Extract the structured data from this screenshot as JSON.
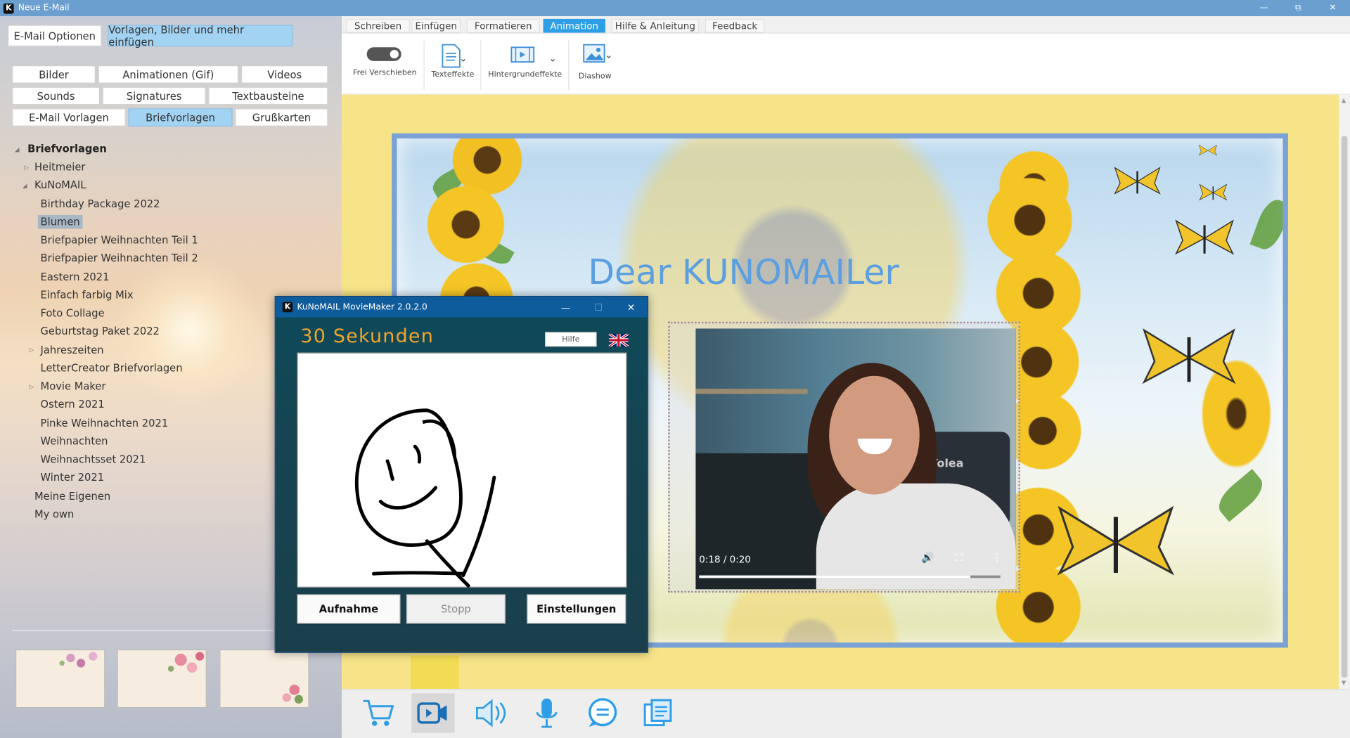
{
  "window": {
    "title": "Neue E-Mail",
    "logo_letter": "K",
    "controls": {
      "minimize": "—",
      "restore": "⧉",
      "close": "✕"
    }
  },
  "left": {
    "main_buttons": [
      "E-Mail Optionen",
      "Vorlagen, Bilder und mehr einfügen"
    ],
    "categories": [
      "Bilder",
      "Animationen (Gif)",
      "Videos",
      "Sounds",
      "Signatures",
      "Textbausteine",
      "E-Mail Vorlagen",
      "Briefvorlagen",
      "Grußkarten"
    ],
    "tree": [
      "Briefvorlagen",
      "Heitmeier",
      "KuNoMAIL",
      "Birthday Package 2022",
      "Blumen",
      "Briefpapier Weihnachten Teil 1",
      "Briefpapier Weihnachten Teil 2",
      "Eastern 2021",
      "Einfach farbig Mix",
      "Foto Collage",
      "Geburtstag Paket 2022",
      "Jahreszeiten",
      "LetterCreator Briefvorlagen",
      "Movie Maker",
      "Ostern 2021",
      "Pinke Weihnachten 2021",
      "Weihnachten",
      "Weihnachtsset 2021",
      "Winter 2021",
      "Meine Eigenen",
      "My own"
    ]
  },
  "ribbon": {
    "tabs": [
      "Schreiben",
      "Einfügen",
      "Formatieren",
      "Animation",
      "Hilfe & Anleitung",
      "Feedback"
    ],
    "active_tab": "Animation",
    "groups": [
      "Frei Verschieben",
      "Texteffekte",
      "Hintergrundeffekte",
      "Diashow"
    ]
  },
  "editor": {
    "greeting": "Dear KUNOMAILer",
    "video": {
      "time": "0:18 / 0:20",
      "progress": 0.9,
      "shirt_text": "Yolea"
    }
  },
  "dialog": {
    "title": "KuNoMAIL MovieMaker 2.0.2.0",
    "heading": "30 Sekunden",
    "help": "Hilfe",
    "buttons": [
      "Aufnahme",
      "Stopp",
      "Einstellungen"
    ]
  },
  "colors": {
    "accent": "#2e9ee6",
    "selected_button": "#a3d3f3",
    "dialog_heading": "#f0a52c",
    "greeting": "#5b9fe0",
    "canvas_bg": "#f7e388"
  },
  "bottom_icons": [
    "cart-icon",
    "video-camera-icon",
    "speaker-icon",
    "microphone-icon",
    "chat-icon",
    "gallery-icon"
  ]
}
